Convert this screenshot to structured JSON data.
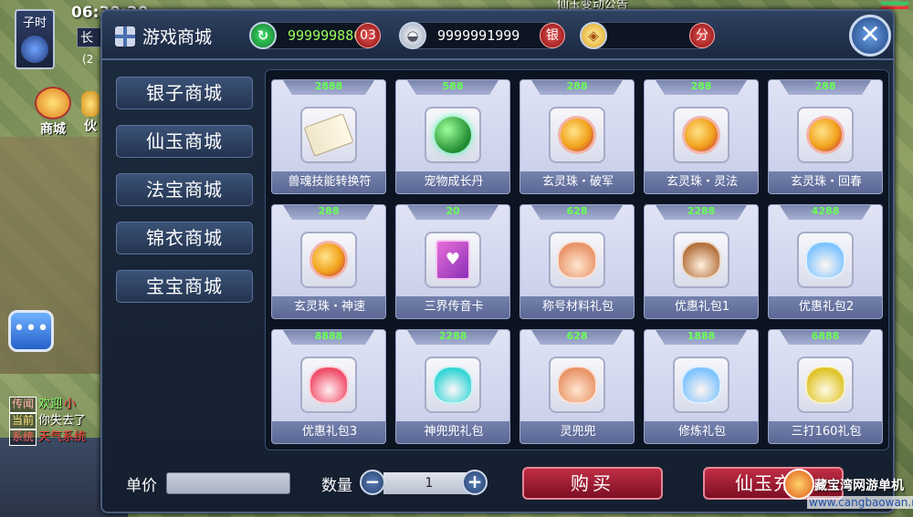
{
  "hud": {
    "time_period": "子时",
    "clock": "06:30:30",
    "location": "长",
    "coords": "(2",
    "mall_label": "商城",
    "side_label": "伙",
    "top_banner": "仙玉变动公告"
  },
  "chat": [
    {
      "tag": "传闻",
      "text": "欢迎",
      "extra": "小"
    },
    {
      "tag": "当前",
      "text": "你失去了"
    },
    {
      "tag": "系统",
      "text": "天气系统"
    }
  ],
  "shop": {
    "title": "游戏商城",
    "currencies": [
      {
        "name": "xianyu",
        "icon": "jade-icon",
        "value": "999999880",
        "badge": "03"
      },
      {
        "name": "silver",
        "icon": "silver-ingot-icon",
        "value": "9999991999",
        "badge": "银"
      },
      {
        "name": "points",
        "icon": "points-card-icon",
        "value": "",
        "badge": "分"
      }
    ],
    "close": "✕",
    "tabs": [
      "银子商城",
      "仙玉商城",
      "法宝商城",
      "锦衣商城",
      "宝宝商城"
    ],
    "items": [
      {
        "price": "2888",
        "name": "兽魂技能转换符",
        "icon": "scroll-icon"
      },
      {
        "price": "588",
        "name": "宠物成长丹",
        "icon": "green-pill-icon"
      },
      {
        "price": "288",
        "name": "玄灵珠・破军",
        "icon": "pearl-icon"
      },
      {
        "price": "288",
        "name": "玄灵珠・灵法",
        "icon": "pearl-icon"
      },
      {
        "price": "288",
        "name": "玄灵珠・回春",
        "icon": "pearl-icon"
      },
      {
        "price": "288",
        "name": "玄灵珠・神速",
        "icon": "pearl-icon"
      },
      {
        "price": "20",
        "name": "三界传音卡",
        "icon": "heart-card-icon"
      },
      {
        "price": "628",
        "name": "称号材料礼包",
        "icon": "gift-bag-icon"
      },
      {
        "price": "2288",
        "name": "优惠礼包1",
        "icon": "gift-bag-icon"
      },
      {
        "price": "4288",
        "name": "优惠礼包2",
        "icon": "gift-bag-icon"
      },
      {
        "price": "8888",
        "name": "优惠礼包3",
        "icon": "gift-bag-icon"
      },
      {
        "price": "2288",
        "name": "神兜兜礼包",
        "icon": "gift-bag-icon"
      },
      {
        "price": "628",
        "name": "灵兜兜",
        "icon": "gift-bag-icon"
      },
      {
        "price": "1888",
        "name": "修炼礼包",
        "icon": "gift-bag-icon"
      },
      {
        "price": "6888",
        "name": "三打160礼包",
        "icon": "gift-bag-icon"
      }
    ],
    "unit_price_label": "单价",
    "unit_price_value": "",
    "quantity_label": "数量",
    "quantity_value": "1",
    "minus": "−",
    "plus": "+",
    "buy_label": "购买",
    "recharge_label": "仙玉充值"
  },
  "watermark": {
    "text": "藏宝湾网游单机",
    "url": "www.cangbaowan.net"
  }
}
